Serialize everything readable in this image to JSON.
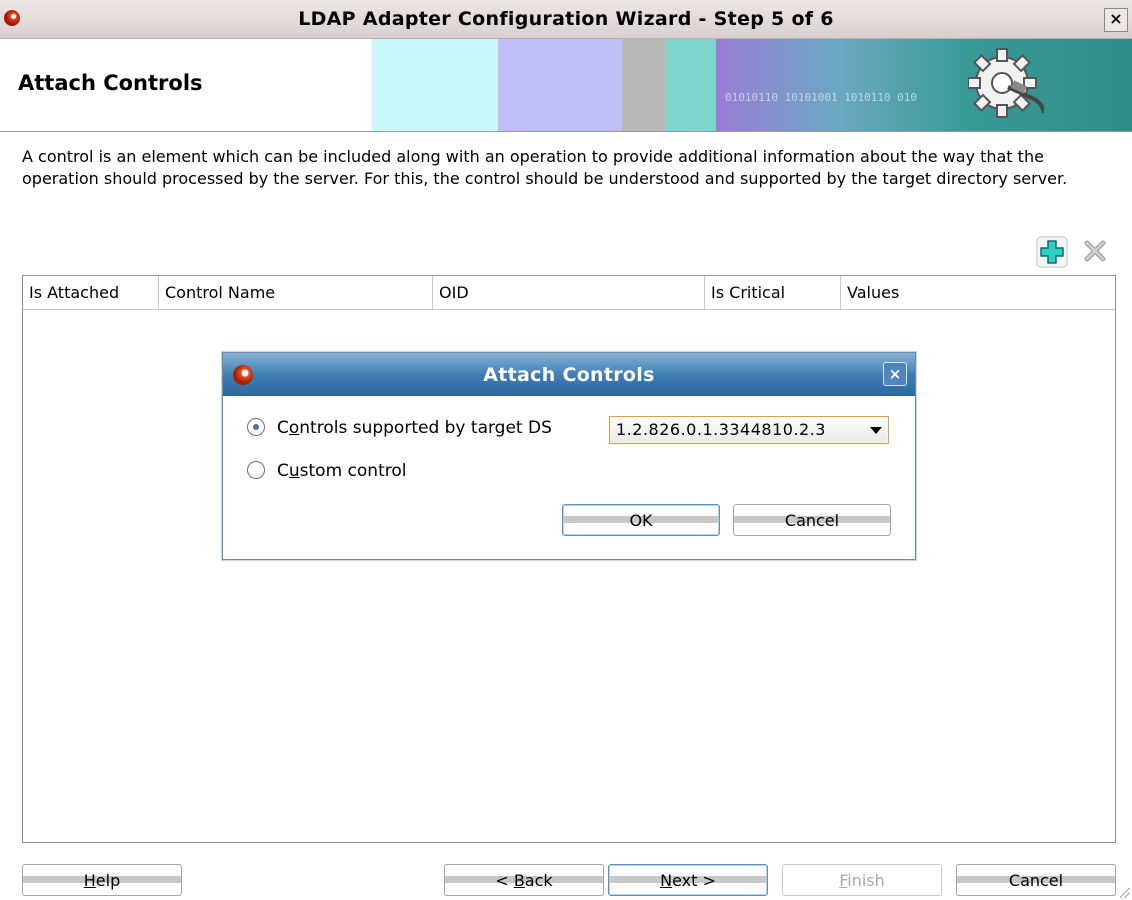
{
  "window": {
    "title": "LDAP Adapter Configuration Wizard - Step 5 of 6",
    "close_glyph": "×"
  },
  "header": {
    "step_title": "Attach Controls",
    "banner_text": "01010110 10101001 1010110 010"
  },
  "description": "A control is an element which can be included along with an operation to provide additional information about the way that the operation should processed by the server. For this, the control should be understood and supported by the target directory server.",
  "toolbar": {
    "add_icon": "plus-icon",
    "delete_icon": "delete-x-icon"
  },
  "table": {
    "columns": [
      "Is Attached",
      "Control Name",
      "OID",
      "Is Critical",
      "Values"
    ],
    "rows": []
  },
  "dialog": {
    "title": "Attach Controls",
    "close_glyph": "×",
    "option_supported": {
      "pre": "C",
      "mnemonic": "o",
      "post": "ntrols supported by target DS",
      "selected": true
    },
    "option_custom": {
      "pre": "C",
      "mnemonic": "u",
      "post": "stom control",
      "selected": false
    },
    "control_select_value": "1.2.826.0.1.3344810.2.3",
    "ok_label": "OK",
    "cancel_label": "Cancel"
  },
  "footer": {
    "help": {
      "pre": "",
      "mnemonic": "H",
      "post": "elp"
    },
    "back": {
      "pre": "< ",
      "mnemonic": "B",
      "post": "ack"
    },
    "next": {
      "pre": "",
      "mnemonic": "N",
      "post": "ext >"
    },
    "finish": {
      "pre": "",
      "mnemonic": "F",
      "post": "inish"
    },
    "cancel": "Cancel"
  },
  "colors": {
    "dialog_title_bar": "#3d7bb2",
    "add_icon": "#22c6b8",
    "select_border": "#d8a050"
  }
}
